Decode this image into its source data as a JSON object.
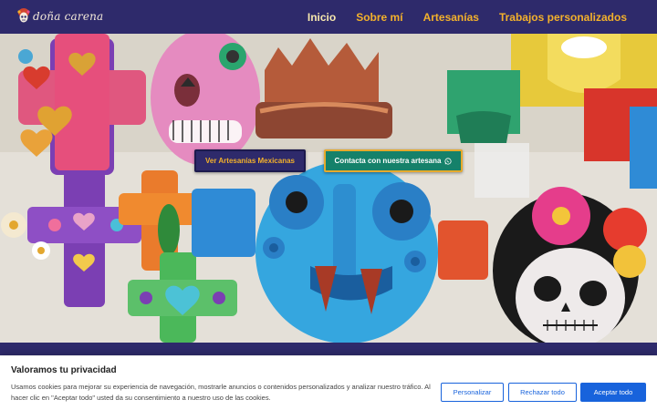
{
  "header": {
    "logo_text": "doña carena",
    "nav": [
      {
        "label": "Inicio",
        "active": true
      },
      {
        "label": "Sobre mí",
        "active": false
      },
      {
        "label": "Artesanías",
        "active": false
      },
      {
        "label": "Trabajos personalizados",
        "active": false
      }
    ]
  },
  "hero": {
    "primary_button": "Ver Artesanías Mexicanas",
    "secondary_button": "Contacta con nuestra artesana",
    "secondary_icon": "whatsapp-icon"
  },
  "cookie_banner": {
    "title": "Valoramos tu privacidad",
    "text": "Usamos cookies para mejorar su experiencia de navegación, mostrarle anuncios o contenidos personalizados y analizar nuestro tráfico. Al hacer clic en \"Aceptar todo\" usted da su consentimiento a nuestro uso de las cookies.",
    "buttons": {
      "customize": "Personalizar",
      "reject": "Rechazar todo",
      "accept": "Aceptar todo"
    }
  },
  "colors": {
    "brand_navy": "#2e2a6b",
    "brand_gold": "#f3b12b",
    "brand_green": "#15816a",
    "cookie_blue": "#1863dc"
  }
}
